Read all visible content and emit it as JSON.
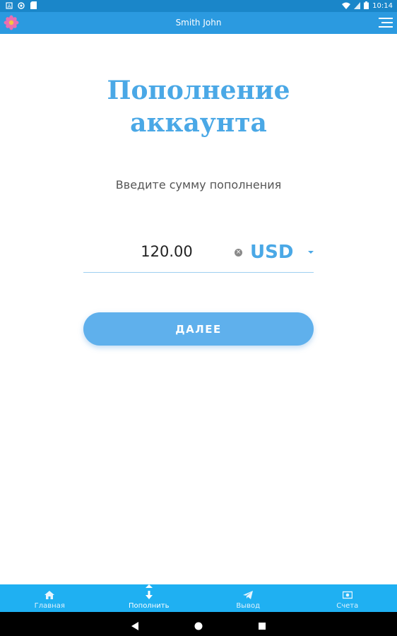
{
  "status_bar": {
    "time": "10:14"
  },
  "app_bar": {
    "title": "Smith John"
  },
  "main": {
    "title_line1": "Пополнение",
    "title_line2": "аккаунта",
    "subtitle": "Введите сумму пополнения",
    "amount": "120.00",
    "currency": "USD",
    "next_label": "ДАЛЕЕ"
  },
  "bottom_nav": {
    "items": [
      {
        "label": "Главная",
        "icon": "home-icon"
      },
      {
        "label": "Пополнить",
        "icon": "arrow-down-icon",
        "active": true
      },
      {
        "label": "Вывод",
        "icon": "paper-plane-icon"
      },
      {
        "label": "Счета",
        "icon": "banknote-icon"
      }
    ]
  },
  "colors": {
    "status_bar": "#1a86c9",
    "app_bar": "#2b9ae0",
    "accent": "#4aa8e6",
    "button": "#5fb0ec",
    "bottom_nav": "#1fb0f2"
  }
}
